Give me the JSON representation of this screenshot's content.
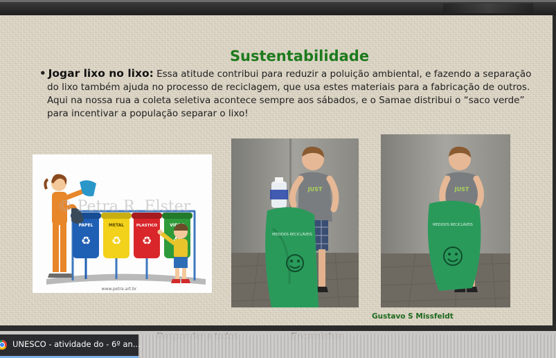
{
  "slide": {
    "title": "Sustentabilidade",
    "bullet_marker": "•",
    "lead": "Jogar lixo no lixo:",
    "text_line1": " Essa atitude contribui para reduzir a poluição ambiental, e fazendo a separação",
    "text_line2": "do lixo também ajuda no processo de reciclagem, que usa estes materiais para a fabricação de outros.",
    "text_line3": "Aqui na nossa rua a coleta seletiva acontece sempre aos sábados, e o Samae distribui o “saco verde”",
    "text_line4": "para incentivar a população  separar o lixo!",
    "bins": {
      "papel": "PAPEL",
      "metal": "METAL",
      "plastico": "PLASTICO",
      "vidro": "VIDRO",
      "watermark": "© Petra R. Elster",
      "site": "www.petra.art.br"
    },
    "photo_credit": "Gustavo S Missfeldt",
    "bag_print": "MEDIDOS RECICLÁVEIS"
  },
  "taskbar": {
    "tab_label": "UNESCO - atividade do - 6º an...",
    "faded_reply_all": "Responder a todos",
    "faded_forward": "Encaminhar"
  },
  "colors": {
    "title_green": "#1d7a1d",
    "bin_blue": "#1f5fb4",
    "bin_yellow": "#f2d21a",
    "bin_red": "#d9262a",
    "bin_green": "#2f9a3a",
    "bag_green": "#2a9a5b"
  },
  "icons": [
    "chrome-icon",
    "recycle-icon"
  ]
}
